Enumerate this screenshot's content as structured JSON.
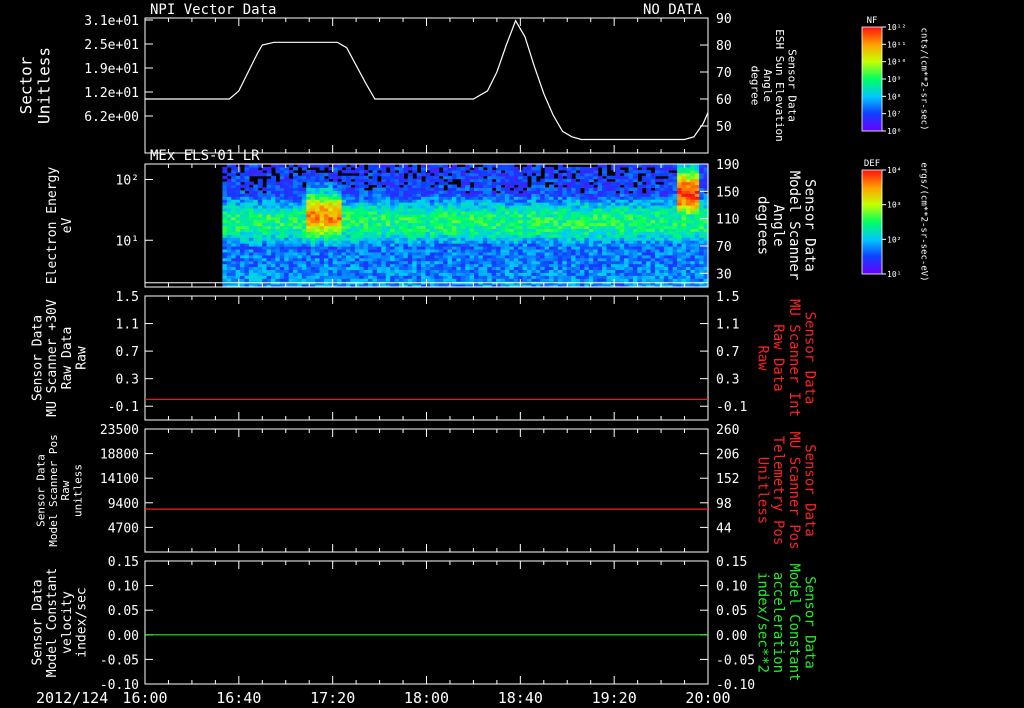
{
  "colors": {
    "background": "#000000",
    "axis": "#ffffff",
    "panel3_line": "#ff2020",
    "panel4_line": "#ff2020",
    "panel5_line": "#22ee22",
    "right_label_red": "#ff2020",
    "right_label_green": "#22ee22"
  },
  "footer": {
    "date": "2012/124"
  },
  "time_axis": {
    "start": "16:00",
    "end": "20:00",
    "tick_labels": [
      "16:00",
      "16:40",
      "17:20",
      "18:00",
      "18:40",
      "19:20",
      "20:00"
    ],
    "tick_minutes": [
      0,
      40,
      80,
      120,
      160,
      200,
      240
    ]
  },
  "colorbars": [
    {
      "title": "NF",
      "unit_label": "cnts/(cm**2-sr-sec)",
      "tick_labels": [
        "10¹²",
        "10¹¹",
        "10¹⁰",
        "10⁹",
        "10⁸",
        "10⁷",
        "10⁶"
      ]
    },
    {
      "title": "DEF",
      "unit_label": "ergs/(cm**2-sr-sec-eV)",
      "tick_labels": [
        "10⁴",
        "10³",
        "10²",
        "10¹"
      ]
    }
  ],
  "chart_data": [
    {
      "type": "line",
      "title": "NPI Vector Data",
      "status": "NO DATA",
      "left_axis": {
        "label_lines": [
          "Sector",
          "Unitless"
        ],
        "tick_labels": [
          "3.1e+01",
          "2.5e+01",
          "1.9e+01",
          "1.2e+01",
          "6.2e+00"
        ]
      },
      "right_axis": {
        "label_lines": [
          "Sensor Data",
          "ESH Sun Elevation",
          "Angle",
          "degree"
        ],
        "ylim": [
          40,
          90
        ],
        "tick_values": [
          50,
          60,
          70,
          80,
          90
        ],
        "tick_labels": [
          "50",
          "60",
          "70",
          "80",
          "90"
        ]
      },
      "series": [
        {
          "x_minutes": [
            0,
            36,
            40,
            44,
            48,
            50,
            55,
            70,
            78,
            82,
            86,
            94,
            98,
            110,
            140,
            146,
            150,
            154,
            158,
            162,
            166,
            170,
            174,
            178,
            182,
            186,
            190,
            194,
            200,
            220,
            230,
            234,
            238,
            240
          ],
          "y_deg": [
            60,
            60,
            63,
            70,
            77,
            80,
            81,
            81,
            81,
            81,
            79,
            66,
            60,
            60,
            60,
            63,
            70,
            80,
            89,
            83,
            72,
            62,
            54,
            48,
            46,
            45,
            45,
            45,
            45,
            45,
            45,
            46,
            51,
            55
          ]
        }
      ]
    },
    {
      "type": "heatmap",
      "title": "MEx ELS-01 LR",
      "left_axis": {
        "label_lines": [
          "Electron Energy",
          "eV"
        ],
        "scale": "log",
        "ylim": [
          1.7,
          180
        ],
        "tick_labels": [
          "10¹",
          "10²"
        ],
        "tick_values": [
          10,
          100
        ]
      },
      "right_axis": {
        "label_lines": [
          "Sensor Data",
          "Model Scanner",
          "Angle",
          "degrees"
        ],
        "ylim": [
          10,
          190
        ],
        "tick_values": [
          30,
          70,
          110,
          150,
          190
        ],
        "tick_labels": [
          "30",
          "70",
          "110",
          "150",
          "190"
        ]
      },
      "data_start_minutes": 33,
      "reference_line_eV": 2.0,
      "features": [
        {
          "x_range_minutes": [
            33,
            240
          ],
          "peak_eV": 20,
          "intensity": 0.5
        },
        {
          "x_range_minutes": [
            67,
            82
          ],
          "peak_eV": 25,
          "intensity": 0.85
        },
        {
          "x_range_minutes": [
            225,
            236
          ],
          "peak_eV": 60,
          "intensity": 0.95
        }
      ]
    },
    {
      "type": "line",
      "left_axis": {
        "label_lines": [
          "Sensor Data",
          "MU Scanner +30V",
          "Raw Data",
          "Raw"
        ],
        "ylim": [
          -0.3,
          1.5
        ],
        "tick_values": [
          -0.1,
          0.3,
          0.7,
          1.1,
          1.5
        ],
        "tick_labels": [
          "-0.1",
          "0.3",
          "0.7",
          "1.1",
          "1.5"
        ]
      },
      "right_axis": {
        "label_lines": [
          "Sensor Data",
          "MU Scanner Int",
          "Raw Data",
          "Raw"
        ],
        "ylim": [
          -0.3,
          1.5
        ],
        "tick_values": [
          -0.1,
          0.3,
          0.7,
          1.1,
          1.5
        ],
        "tick_labels": [
          "-0.1",
          "0.3",
          "0.7",
          "1.1",
          "1.5"
        ]
      },
      "series": [
        {
          "x_minutes": [
            0,
            240
          ],
          "y": [
            0.0,
            0.0
          ]
        }
      ]
    },
    {
      "type": "line",
      "left_axis": {
        "label_lines": [
          "Sensor Data",
          "Model Scanner Pos",
          "Raw",
          "unitless"
        ],
        "ylim": [
          0,
          23500
        ],
        "tick_values": [
          4700,
          9400,
          14100,
          18800,
          23500
        ],
        "tick_labels": [
          "4700",
          "9400",
          "14100",
          "18800",
          "23500"
        ]
      },
      "right_axis": {
        "label_lines": [
          "Sensor Data",
          "MU Scanner Pos",
          "Telemetry Pos",
          "Unitless"
        ],
        "ylim": [
          -10,
          260
        ],
        "tick_values": [
          44,
          98,
          152,
          206,
          260
        ],
        "tick_labels": [
          "44",
          "98",
          "152",
          "206",
          "260"
        ]
      },
      "series": [
        {
          "x_minutes": [
            0,
            240
          ],
          "y": [
            8200,
            8200
          ]
        }
      ]
    },
    {
      "type": "line",
      "left_axis": {
        "label_lines": [
          "Sensor Data",
          "Model Constant",
          "velocity",
          "index/sec"
        ],
        "ylim": [
          -0.1,
          0.15
        ],
        "tick_values": [
          -0.1,
          -0.05,
          0.0,
          0.05,
          0.1,
          0.15
        ],
        "tick_labels": [
          "-0.10",
          "-0.05",
          "0.00",
          "0.05",
          "0.10",
          "0.15"
        ]
      },
      "right_axis": {
        "label_lines": [
          "Sensor Data",
          "Model Constant",
          "acceleration",
          "index/sec**2"
        ],
        "ylim": [
          -0.1,
          0.15
        ],
        "tick_values": [
          -0.1,
          -0.05,
          0.0,
          0.05,
          0.1,
          0.15
        ],
        "tick_labels": [
          "-0.10",
          "-0.05",
          "0.00",
          "0.05",
          "0.10",
          "0.15"
        ]
      },
      "series": [
        {
          "x_minutes": [
            0,
            240
          ],
          "y": [
            0.0,
            0.0
          ]
        }
      ]
    }
  ]
}
